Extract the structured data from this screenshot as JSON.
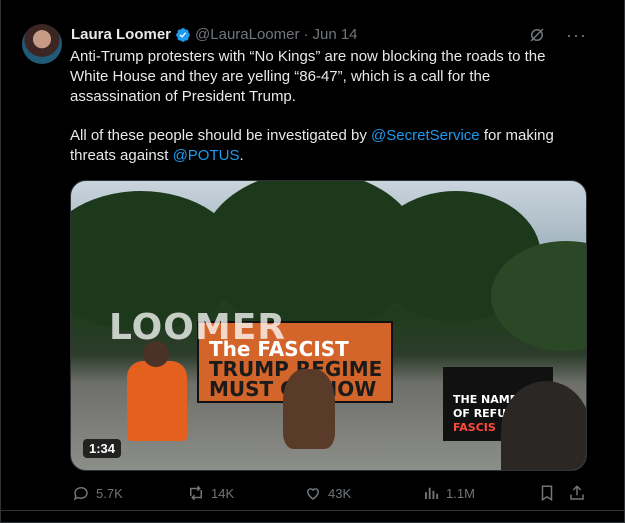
{
  "tweet": {
    "author_name": "Laura Loomer",
    "handle": "@LauraLoomer",
    "separator": "·",
    "date": "Jun 14",
    "more_label": "···",
    "text_line1": "Anti-Trump protesters with “No Kings” are now blocking the roads to the",
    "text_line2": "White House and they are yelling “86-47”, which is a call for the",
    "text_line3": "assassination of President Trump.",
    "text2_a": "All of these people should be investigated by ",
    "mention1": "@SecretService",
    "text2_b": " for making",
    "text2_c": "threats against ",
    "mention2": "@POTUS",
    "text2_d": "."
  },
  "media": {
    "duration": "1:34",
    "watermark": "LOOMER",
    "banner_line1": "The FASCIST",
    "banner_line2": "TRUMP REGIME",
    "banner_line3": "MUST GO NOW",
    "sign_line1": "THE NAME",
    "sign_line2": "OF REFUSE",
    "sign_line3": "FASCIS"
  },
  "actions": {
    "replies": "5.7K",
    "reposts": "14K",
    "likes": "43K",
    "views": "1.1M"
  },
  "colors": {
    "link": "#1d9bf0",
    "muted": "#71767b",
    "text": "#e7e9ea",
    "verified": "#1d9bf0"
  }
}
